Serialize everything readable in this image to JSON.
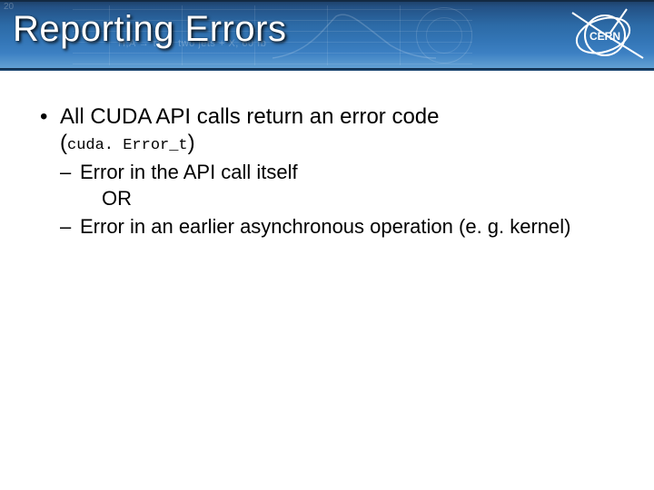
{
  "header": {
    "title": "Reporting Errors",
    "logo_name": "CERN",
    "bg_tick": "20",
    "bg_formula": "H,A → ττ → two jets + X, 60 fb"
  },
  "body": {
    "bullet1_line1": "All CUDA API calls return an error code",
    "bullet1_paren_open": "(",
    "bullet1_code": "cuda. Error_t",
    "bullet1_paren_close": ")",
    "sub1": "Error in the API call itself",
    "or_line": "OR",
    "sub2": "Error in an earlier asynchronous operation (e. g. kernel)"
  }
}
